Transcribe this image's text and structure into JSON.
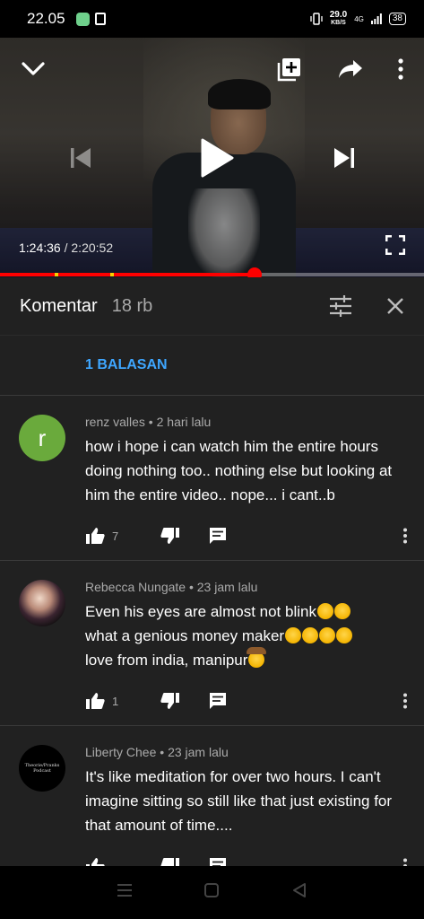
{
  "status_bar": {
    "time": "22.05",
    "net_speed_value": "29.0",
    "net_speed_unit": "KB/S",
    "network": "4G",
    "battery": "38"
  },
  "player": {
    "current_time": "1:24:36",
    "separator": "/",
    "duration": "2:20:52",
    "progress_fraction": 0.601,
    "ad_marker_fractions": [
      0.13,
      0.26
    ]
  },
  "comments_panel": {
    "title": "Komentar",
    "count": "18 rb",
    "replies_link": "1 BALASAN",
    "comments": [
      {
        "avatar_letter": "r",
        "author": "renz valles",
        "time": "2 hari lalu",
        "text": "how i hope i can watch him the entire hours doing nothing too.. nothing else but looking at him the entire video.. nope... i cant..b",
        "likes": "7"
      },
      {
        "author": "Rebecca Nungate",
        "time": "23 jam lalu",
        "text_line1": "Even his eyes are almost not blink",
        "text_line2": "what a genious money maker",
        "text_line3": "love from india, manipur",
        "likes": "1"
      },
      {
        "avatar_text": "Theorie/Pranks Podcast",
        "author": "Liberty Chee",
        "time": "23 jam lalu",
        "text": "It's like meditation for over two hours. I can't imagine sitting so still like that just existing for that amount of time....",
        "likes": ""
      }
    ]
  },
  "colors": {
    "progress": "#ff0000",
    "ad_marker": "#f7d100",
    "link": "#3ea6ff",
    "panel_bg": "#212121"
  }
}
